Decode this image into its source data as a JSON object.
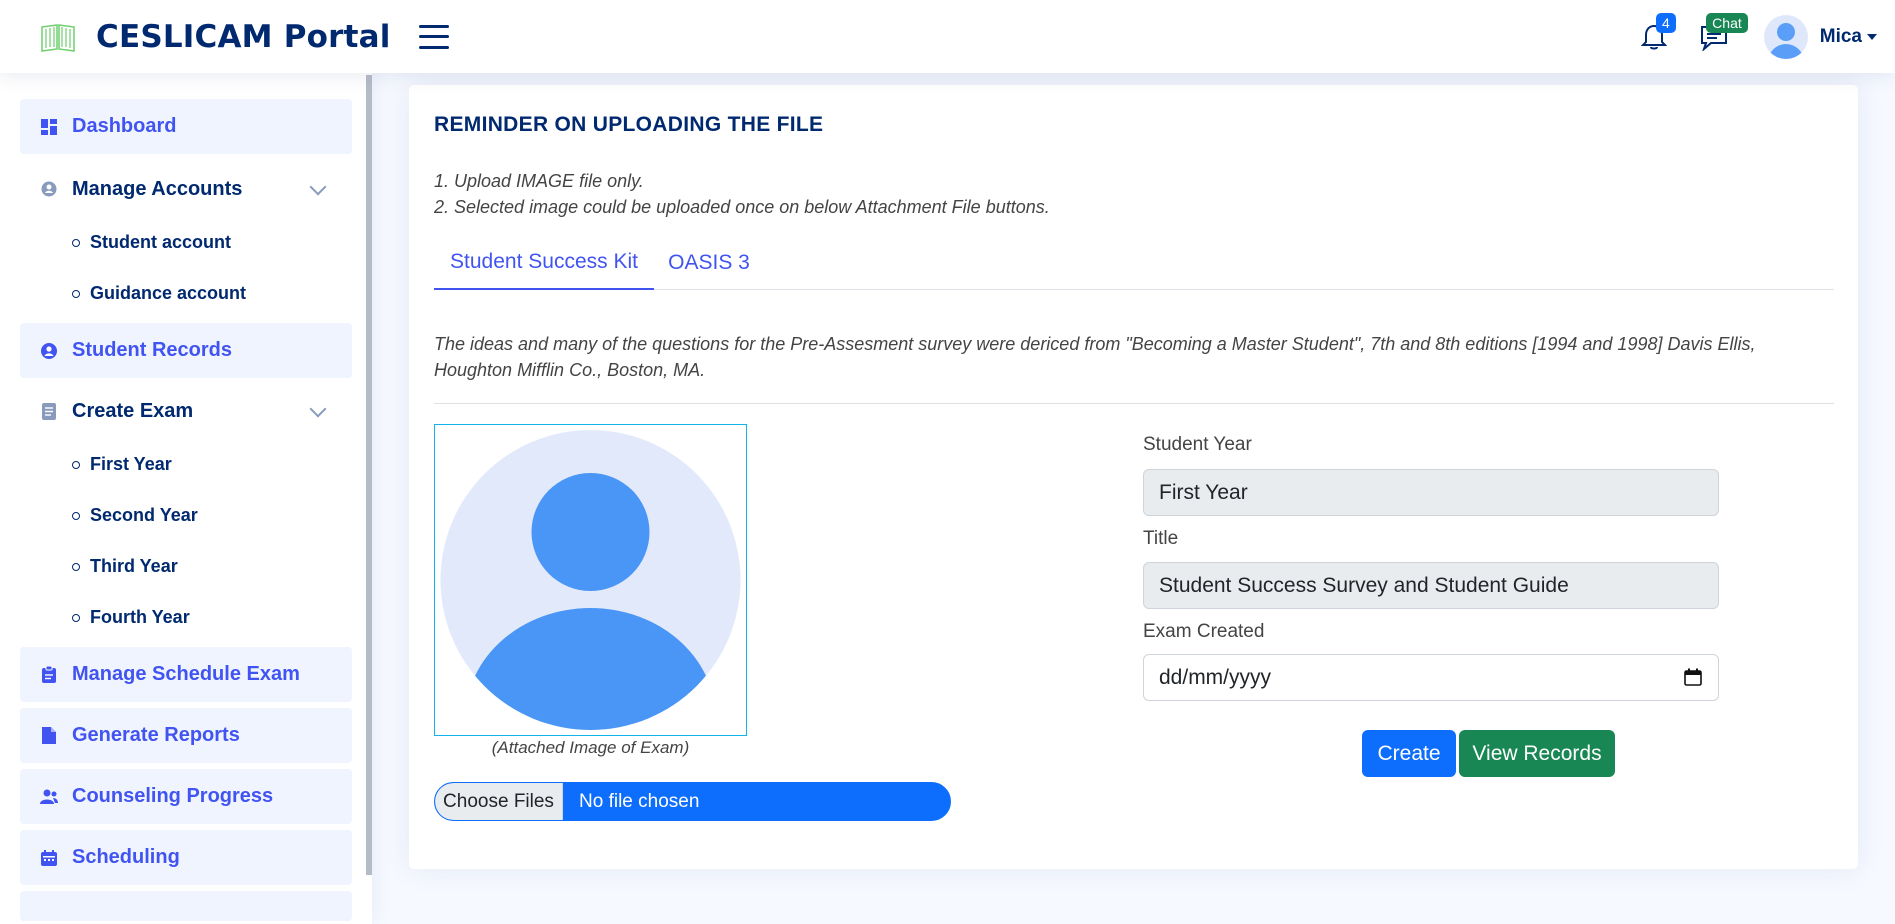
{
  "header": {
    "app_title": "CESLICAM Portal",
    "notification_count": "4",
    "chat_badge": "Chat",
    "user_name": "Mica"
  },
  "sidebar": {
    "items": [
      {
        "label": "Dashboard",
        "icon": "grid-icon"
      },
      {
        "label": "Manage Accounts",
        "icon": "person-pin-icon",
        "expanded": true,
        "children": [
          "Student account",
          "Guidance account"
        ]
      },
      {
        "label": "Student Records",
        "icon": "person-circle-icon"
      },
      {
        "label": "Create Exam",
        "icon": "document-icon",
        "expanded": true,
        "children": [
          "First Year",
          "Second Year",
          "Third Year",
          "Fourth Year"
        ]
      },
      {
        "label": "Manage Schedule Exam",
        "icon": "clipboard-icon"
      },
      {
        "label": "Generate Reports",
        "icon": "file-icon"
      },
      {
        "label": "Counseling Progress",
        "icon": "people-icon"
      },
      {
        "label": "Scheduling",
        "icon": "calendar-icon"
      }
    ]
  },
  "main": {
    "card_title": "REMINDER ON UPLOADING THE FILE",
    "reminders": [
      "1. Upload IMAGE file only.",
      "2. Selected image could be uploaded once on below Attachment File buttons."
    ],
    "tabs": [
      {
        "label": "Student Success Kit",
        "active": true
      },
      {
        "label": "OASIS 3",
        "active": false
      }
    ],
    "notice": "The ideas and many of the questions for the Pre-Assesment survey were dericed from \"Becoming a Master Student\", 7th and 8th editions [1994 and 1998] Davis Ellis, Houghton Mifflin Co., Boston, MA.",
    "image_caption": "(Attached Image of Exam)",
    "file_button": "Choose Files",
    "file_status": "No file chosen",
    "form": {
      "student_year_label": "Student Year",
      "student_year_value": "First Year",
      "title_label": "Title",
      "title_value": "Student Success Survey and Student Guide",
      "exam_created_label": "Exam Created",
      "exam_created_placeholder": "dd/mm/yyyy"
    },
    "buttons": {
      "create": "Create",
      "view_records": "View Records"
    }
  },
  "colors": {
    "primary": "#4154f1",
    "navy": "#012970",
    "blue_button": "#0d6efd",
    "green_button": "#198754",
    "page_bg": "#f6f9ff"
  }
}
